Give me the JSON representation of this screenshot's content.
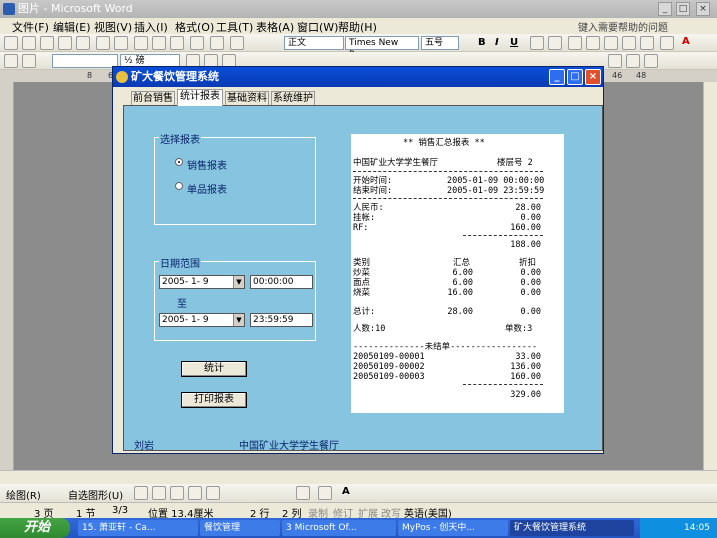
{
  "word": {
    "title": "图片 - Microsoft Word",
    "menu": [
      "文件(F)",
      "编辑(E)",
      "视图(V)",
      "插入(I)",
      "格式(O)",
      "工具(T)",
      "表格(A)",
      "窗口(W)",
      "帮助(H)"
    ],
    "help_placeholder": "键入需要帮助的问题",
    "style_value": "正文",
    "font_value": "Times New Roman",
    "size_value": "五号",
    "line_value": "½ 磅",
    "draw_label": "绘图(R)",
    "autoshape_label": "自选图形(U)",
    "status": {
      "page": "3 页",
      "section": "1 节",
      "pages": "3/3",
      "position": "位置 13.4厘米",
      "line": "2 行",
      "col": "2 列",
      "rec": "录制",
      "trk": "修订",
      "ext": "扩展",
      "ovr": "改写",
      "lang": "英语(美国)"
    }
  },
  "app": {
    "title": "矿大餐饮管理系统",
    "tabs": [
      "前台销售",
      "统计报表",
      "基础资料",
      "系统维护"
    ],
    "selected_tab": "统计报表",
    "report_group": {
      "label": "选择报表",
      "options": [
        "销售报表",
        "单品报表"
      ],
      "selected": "销售报表"
    },
    "date_group": {
      "label": "日期范围",
      "start_date": "2005- 1- 9",
      "start_time": "00:00:00",
      "to_label": "至",
      "end_date": "2005- 1- 9",
      "end_time": "23:59:59"
    },
    "buttons": {
      "stat": "统计",
      "print": "打印报表"
    },
    "report": {
      "title": "** 销售汇总报表 **",
      "restaurant": "中国矿业大学学生餐厅",
      "floor": "楼层号 2",
      "start_label": "开始时间:",
      "start_value": "2005-01-09 00:00:00",
      "end_label": "结束时间:",
      "end_value": "2005-01-09 23:59:59",
      "payments": [
        {
          "label": "人民币:",
          "value": "28.00"
        },
        {
          "label": "挂帐:",
          "value": "0.00"
        },
        {
          "label": "RF:",
          "value": "160.00"
        }
      ],
      "payment_total": "188.00",
      "cat_header": {
        "name": "类别",
        "sum": "汇总",
        "discount": "折扣"
      },
      "categories": [
        {
          "name": "炒菜",
          "sum": "6.00",
          "discount": "0.00"
        },
        {
          "name": "面点",
          "sum": "6.00",
          "discount": "0.00"
        },
        {
          "name": "烧菜",
          "sum": "16.00",
          "discount": "0.00"
        }
      ],
      "total_label": "总计:",
      "total_sum": "28.00",
      "total_discount": "0.00",
      "people": "人数:10",
      "orders": "单数:3",
      "unsettled": "--------------未结单-----------------",
      "bills": [
        {
          "id": "20050109-00001",
          "amount": "33.00"
        },
        {
          "id": "20050109-00002",
          "amount": "136.00"
        },
        {
          "id": "20050109-00003",
          "amount": "160.00"
        }
      ],
      "bills_total": "329.00"
    },
    "footer_user": "刘岩",
    "footer_org": "中国矿业大学学生餐厅"
  },
  "taskbar": {
    "start": "开始",
    "tasks": [
      "15. 萧亚轩 - Ca...",
      "餐饮管理",
      "3 Microsoft Of...",
      "MyPos - 创天中...",
      "矿大餐饮管理系统"
    ],
    "active_task": "矿大餐饮管理系统",
    "clock": "14:05"
  },
  "colors": {
    "panel": "#86c4e0",
    "title_bar": "#0a4fd8",
    "label_text": "#0a246a",
    "taskbar": "#2456c2"
  }
}
